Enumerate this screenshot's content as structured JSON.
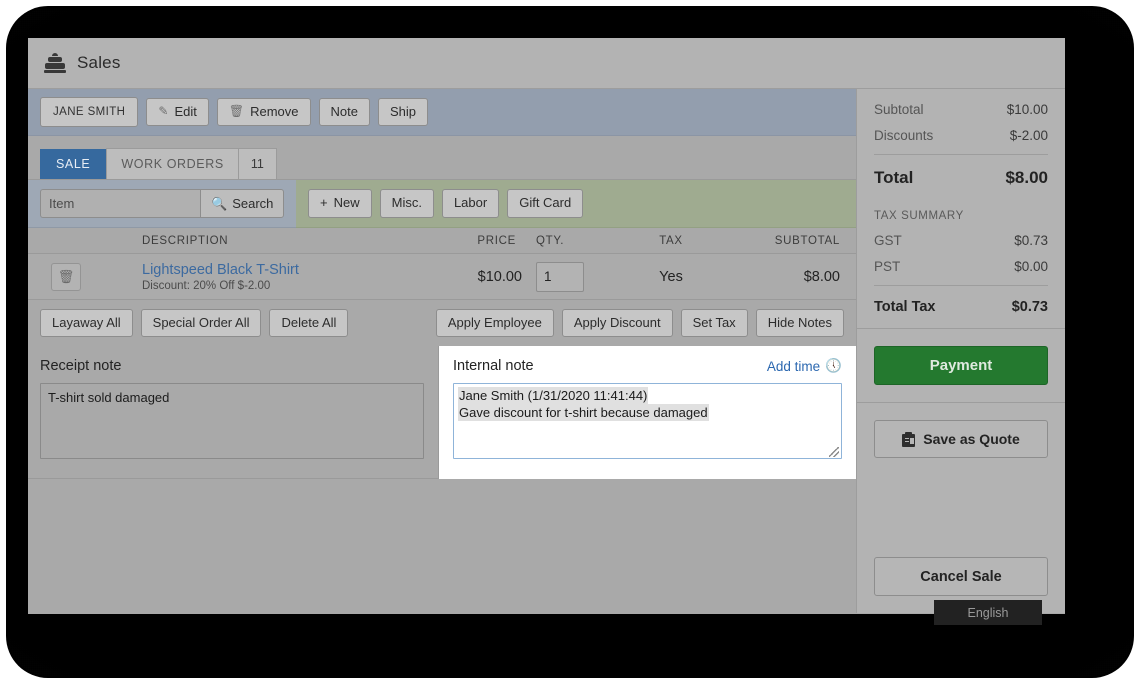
{
  "window": {
    "title": "Sales",
    "title_icon": "cash-register-icon"
  },
  "customer_bar": {
    "customer_name": "JANE SMITH",
    "buttons": [
      {
        "label": "Edit",
        "icon": "pencil-icon"
      },
      {
        "label": "Remove",
        "icon": "trash-icon"
      },
      {
        "label": "Note",
        "icon": ""
      },
      {
        "label": "Ship",
        "icon": ""
      }
    ]
  },
  "tabs": {
    "sale": "SALE",
    "work_orders": "WORK ORDERS",
    "work_orders_count": "11"
  },
  "search": {
    "placeholder": "Item",
    "value": "",
    "button_label": "Search",
    "button_icon": "search-icon"
  },
  "quick_add": {
    "buttons": [
      {
        "label": "New",
        "icon": "plus-icon"
      },
      {
        "label": "Misc.",
        "icon": ""
      },
      {
        "label": "Labor",
        "icon": ""
      },
      {
        "label": "Gift Card",
        "icon": ""
      }
    ]
  },
  "table": {
    "headers": {
      "description": "DESCRIPTION",
      "price": "PRICE",
      "qty": "QTY.",
      "tax": "TAX",
      "subtotal": "SUBTOTAL"
    },
    "rows": [
      {
        "delete_icon": "trash-icon",
        "name": "Lightspeed Black T-Shirt",
        "discount": "Discount: 20% Off $-2.00",
        "price": "$10.00",
        "qty": "1",
        "tax": "Yes",
        "subtotal": "$8.00"
      }
    ]
  },
  "actions": {
    "left": [
      "Layaway All",
      "Special Order All",
      "Delete All"
    ],
    "right": [
      "Apply Employee",
      "Apply Discount",
      "Set Tax",
      "Hide Notes"
    ]
  },
  "receipt_note": {
    "label": "Receipt note",
    "value": "T-shirt sold damaged"
  },
  "internal_note": {
    "label": "Internal note",
    "add_time_label": "Add time",
    "add_time_icon": "clock-icon",
    "lines": [
      "Jane Smith (1/31/2020 11:41:44)",
      "Gave discount for t-shirt because damaged"
    ]
  },
  "totals": {
    "subtotal_label": "Subtotal",
    "subtotal_value": "$10.00",
    "discounts_label": "Discounts",
    "discounts_value": "$-2.00",
    "total_label": "Total",
    "total_value": "$8.00",
    "tax_summary_label": "TAX SUMMARY",
    "taxes": [
      {
        "label": "GST",
        "value": "$0.73"
      },
      {
        "label": "PST",
        "value": "$0.00"
      }
    ],
    "total_tax_label": "Total Tax",
    "total_tax_value": "$0.73"
  },
  "sidebar_actions": {
    "payment": "Payment",
    "save_as_quote": "Save as Quote",
    "save_as_quote_icon": "clipboard-icon",
    "cancel_sale": "Cancel Sale"
  },
  "overlay": {
    "language_badge": "English"
  },
  "colors": {
    "accent_blue": "#36699e",
    "link_blue": "#3c6aa0",
    "payment_green": "#24792f",
    "customer_bar": "#939eae",
    "quick_add_bar": "#9fab90",
    "window_bg": "#a9a9a9"
  }
}
